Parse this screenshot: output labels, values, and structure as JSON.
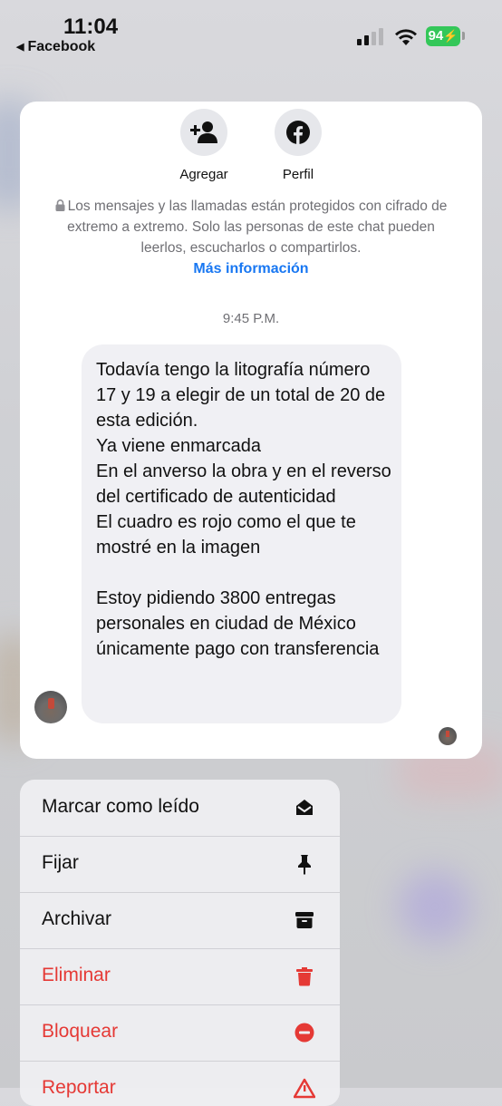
{
  "status_bar": {
    "time": "11:04",
    "back_label": "Facebook",
    "battery": "94"
  },
  "chat": {
    "actions": [
      {
        "label": "Agregar",
        "icon": "add-person-icon"
      },
      {
        "label": "Perfil",
        "icon": "facebook-icon"
      }
    ],
    "e2ee_notice": "Los mensajes y las llamadas están protegidos con cifrado de extremo a extremo. Solo las personas de este chat pueden leerlos, escucharlos o compartirlos.",
    "more_info": "Más información",
    "timestamp": "9:45 P.M.",
    "message": "Todavía tengo la litografía número 17 y 19 a elegir de un total de 20 de esta edición.\nYa viene enmarcada\nEn el anverso la obra y en el reverso del certificado de autenticidad\nEl cuadro es rojo como el que te mostré en la imagen\n\nEstoy pidiendo 3800 entregas personales en ciudad de México únicamente pago con transferencia"
  },
  "menu": {
    "items": [
      {
        "label": "Marcar como leído",
        "icon": "mark-read-icon",
        "danger": false
      },
      {
        "label": "Fijar",
        "icon": "pin-icon",
        "danger": false
      },
      {
        "label": "Archivar",
        "icon": "archive-icon",
        "danger": false
      },
      {
        "label": "Eliminar",
        "icon": "trash-icon",
        "danger": true
      },
      {
        "label": "Bloquear",
        "icon": "block-icon",
        "danger": true
      },
      {
        "label": "Reportar",
        "icon": "report-icon",
        "danger": true
      }
    ]
  },
  "colors": {
    "accent": "#1877f2",
    "danger": "#e53935",
    "battery": "#34c759"
  }
}
